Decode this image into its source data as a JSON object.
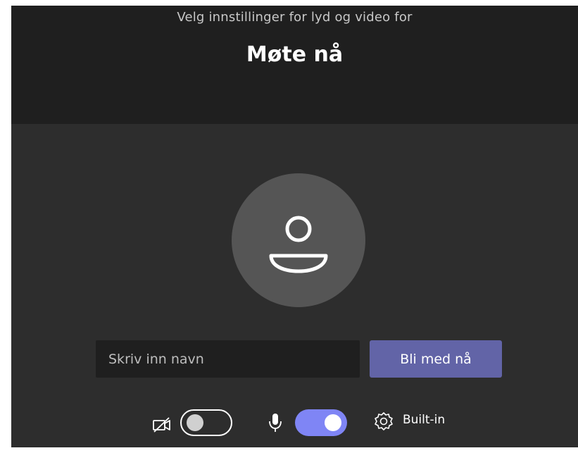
{
  "header": {
    "subtitle": "Velg innstillinger for lyd og video for",
    "title": "Møte nå"
  },
  "name_input": {
    "placeholder": "Skriv inn navn",
    "value": ""
  },
  "join_button": {
    "label": "Bli med nå"
  },
  "controls": {
    "camera_on": false,
    "microphone_on": true,
    "audio_device": "Built-in"
  },
  "icons": {
    "camera": "camera-off-icon",
    "microphone": "microphone-icon",
    "settings": "gear-icon",
    "avatar": "person-icon"
  },
  "colors": {
    "accent": "#6264a7",
    "toggle_on": "#7f85f5",
    "background": "#1f1f1f",
    "panel": "#2d2d2d",
    "avatar_bg": "#555555"
  }
}
